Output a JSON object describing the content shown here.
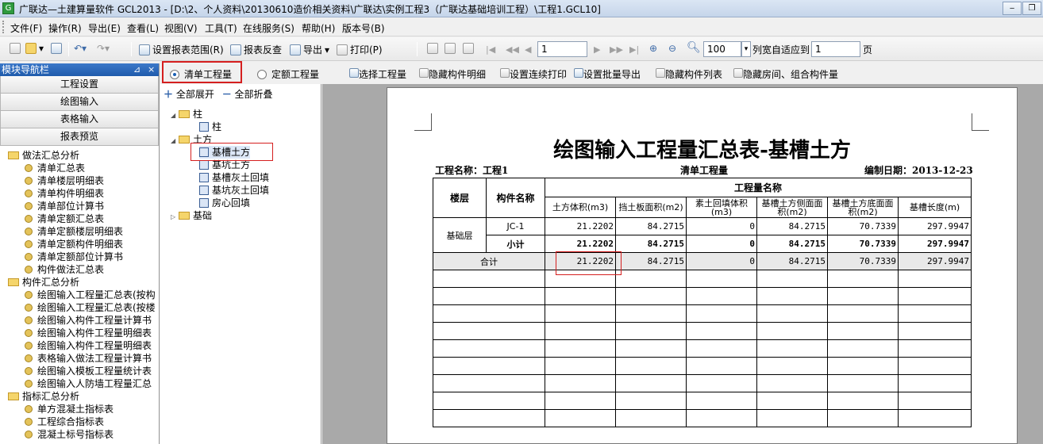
{
  "window": {
    "title": "广联达—土建算量软件 GCL2013 - [D:\\2、个人资料\\20130610造价相关资料\\广联达\\实例工程3（广联达基础培训工程）\\工程1.GCL10]",
    "app_icon": "app-icon"
  },
  "menu": [
    "文件(F)",
    "操作(R)",
    "导出(E)",
    "查看(L)",
    "视图(V)",
    "工具(T)",
    "在线服务(S)",
    "帮助(H)",
    "版本号(B)"
  ],
  "toolbar": {
    "set_range": "设置报表范围(R)",
    "report_check": "报表反查",
    "export": "导出",
    "print": "打印(P)",
    "page_value": "1",
    "zoom_value": "100",
    "column_fit": "列宽自适应到",
    "column_fit_value": "1",
    "page_unit": "页"
  },
  "left_panel": {
    "header": "模块导航栏",
    "pin": "⊿",
    "close": "×",
    "nav_buttons": [
      "工程设置",
      "绘图输入",
      "表格输入",
      "报表预览"
    ],
    "tree": [
      {
        "type": "folder",
        "label": "做法汇总分析"
      },
      {
        "type": "item",
        "label": "清单汇总表"
      },
      {
        "type": "item",
        "label": "清单楼层明细表"
      },
      {
        "type": "item",
        "label": "清单构件明细表"
      },
      {
        "type": "item",
        "label": "清单部位计算书"
      },
      {
        "type": "item",
        "label": "清单定额汇总表"
      },
      {
        "type": "item",
        "label": "清单定额楼层明细表"
      },
      {
        "type": "item",
        "label": "清单定额构件明细表"
      },
      {
        "type": "item",
        "label": "清单定额部位计算书"
      },
      {
        "type": "item",
        "label": "构件做法汇总表"
      },
      {
        "type": "folder",
        "label": "构件汇总分析"
      },
      {
        "type": "item",
        "label": "绘图输入工程量汇总表(按构"
      },
      {
        "type": "item",
        "label": "绘图输入工程量汇总表(按楼"
      },
      {
        "type": "item",
        "label": "绘图输入构件工程量计算书"
      },
      {
        "type": "item",
        "label": "绘图输入构件工程量明细表"
      },
      {
        "type": "item",
        "label": "绘图输入构件工程量明细表"
      },
      {
        "type": "item",
        "label": "表格输入做法工程量计算书"
      },
      {
        "type": "item",
        "label": "绘图输入模板工程量统计表"
      },
      {
        "type": "item",
        "label": "绘图输入人防墙工程量汇总"
      },
      {
        "type": "folder",
        "label": "指标汇总分析"
      },
      {
        "type": "item",
        "label": "单方混凝土指标表"
      },
      {
        "type": "item",
        "label": "工程综合指标表"
      },
      {
        "type": "item",
        "label": "混凝土标号指标表"
      }
    ]
  },
  "radio_bar": {
    "option1": "清单工程量",
    "option2": "定额工程量",
    "select_qty": "选择工程量",
    "hide_detail": "隐藏构件明细",
    "continuous_print": "设置连续打印",
    "batch_export": "设置批量导出",
    "hide_list": "隐藏构件列表",
    "hide_rooms": "隐藏房间、组合构件量"
  },
  "mid_panel": {
    "expand_all": "全部展开",
    "collapse_all": "全部折叠",
    "tree": {
      "zhu": "柱",
      "zhu_child": "柱",
      "tufang": "土方",
      "items": [
        "基槽土方",
        "基坑土方",
        "基槽灰土回填",
        "基坑灰土回填",
        "房心回填"
      ],
      "jichu": "基础"
    }
  },
  "report": {
    "title": "绘图输入工程量汇总表-基槽土方",
    "project_label": "工程名称：工程1",
    "qty_type": "清单工程量",
    "date_label": "编制日期：2013-12-23",
    "col_floor": "楼层",
    "col_name": "构件名称",
    "col_group": "工程量名称",
    "sub_headers": [
      "土方体积(m3)",
      "挡土板面积(m2)",
      "素土回填体积(m3)",
      "基槽土方侧面面积(m2)",
      "基槽土方底面面积(m2)",
      "基槽长度(m)"
    ],
    "floor": "基础层",
    "rows": [
      {
        "name": "JC-1",
        "values": [
          "21.2202",
          "84.2715",
          "0",
          "84.2715",
          "70.7339",
          "297.9947"
        ]
      },
      {
        "name": "小计",
        "values": [
          "21.2202",
          "84.2715",
          "0",
          "84.2715",
          "70.7339",
          "297.9947"
        ]
      }
    ],
    "total": {
      "name": "合计",
      "values": [
        "21.2202",
        "84.2715",
        "0",
        "84.2715",
        "70.7339",
        "297.9947"
      ]
    }
  }
}
